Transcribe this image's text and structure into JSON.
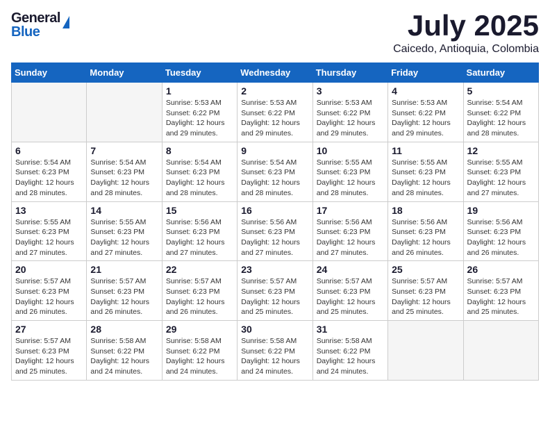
{
  "header": {
    "logo_general": "General",
    "logo_blue": "Blue",
    "month_title": "July 2025",
    "subtitle": "Caicedo, Antioquia, Colombia"
  },
  "calendar": {
    "days_of_week": [
      "Sunday",
      "Monday",
      "Tuesday",
      "Wednesday",
      "Thursday",
      "Friday",
      "Saturday"
    ],
    "weeks": [
      [
        {
          "day": "",
          "info": ""
        },
        {
          "day": "",
          "info": ""
        },
        {
          "day": "1",
          "info": "Sunrise: 5:53 AM\nSunset: 6:22 PM\nDaylight: 12 hours and 29 minutes."
        },
        {
          "day": "2",
          "info": "Sunrise: 5:53 AM\nSunset: 6:22 PM\nDaylight: 12 hours and 29 minutes."
        },
        {
          "day": "3",
          "info": "Sunrise: 5:53 AM\nSunset: 6:22 PM\nDaylight: 12 hours and 29 minutes."
        },
        {
          "day": "4",
          "info": "Sunrise: 5:53 AM\nSunset: 6:22 PM\nDaylight: 12 hours and 29 minutes."
        },
        {
          "day": "5",
          "info": "Sunrise: 5:54 AM\nSunset: 6:22 PM\nDaylight: 12 hours and 28 minutes."
        }
      ],
      [
        {
          "day": "6",
          "info": "Sunrise: 5:54 AM\nSunset: 6:23 PM\nDaylight: 12 hours and 28 minutes."
        },
        {
          "day": "7",
          "info": "Sunrise: 5:54 AM\nSunset: 6:23 PM\nDaylight: 12 hours and 28 minutes."
        },
        {
          "day": "8",
          "info": "Sunrise: 5:54 AM\nSunset: 6:23 PM\nDaylight: 12 hours and 28 minutes."
        },
        {
          "day": "9",
          "info": "Sunrise: 5:54 AM\nSunset: 6:23 PM\nDaylight: 12 hours and 28 minutes."
        },
        {
          "day": "10",
          "info": "Sunrise: 5:55 AM\nSunset: 6:23 PM\nDaylight: 12 hours and 28 minutes."
        },
        {
          "day": "11",
          "info": "Sunrise: 5:55 AM\nSunset: 6:23 PM\nDaylight: 12 hours and 28 minutes."
        },
        {
          "day": "12",
          "info": "Sunrise: 5:55 AM\nSunset: 6:23 PM\nDaylight: 12 hours and 27 minutes."
        }
      ],
      [
        {
          "day": "13",
          "info": "Sunrise: 5:55 AM\nSunset: 6:23 PM\nDaylight: 12 hours and 27 minutes."
        },
        {
          "day": "14",
          "info": "Sunrise: 5:55 AM\nSunset: 6:23 PM\nDaylight: 12 hours and 27 minutes."
        },
        {
          "day": "15",
          "info": "Sunrise: 5:56 AM\nSunset: 6:23 PM\nDaylight: 12 hours and 27 minutes."
        },
        {
          "day": "16",
          "info": "Sunrise: 5:56 AM\nSunset: 6:23 PM\nDaylight: 12 hours and 27 minutes."
        },
        {
          "day": "17",
          "info": "Sunrise: 5:56 AM\nSunset: 6:23 PM\nDaylight: 12 hours and 27 minutes."
        },
        {
          "day": "18",
          "info": "Sunrise: 5:56 AM\nSunset: 6:23 PM\nDaylight: 12 hours and 26 minutes."
        },
        {
          "day": "19",
          "info": "Sunrise: 5:56 AM\nSunset: 6:23 PM\nDaylight: 12 hours and 26 minutes."
        }
      ],
      [
        {
          "day": "20",
          "info": "Sunrise: 5:57 AM\nSunset: 6:23 PM\nDaylight: 12 hours and 26 minutes."
        },
        {
          "day": "21",
          "info": "Sunrise: 5:57 AM\nSunset: 6:23 PM\nDaylight: 12 hours and 26 minutes."
        },
        {
          "day": "22",
          "info": "Sunrise: 5:57 AM\nSunset: 6:23 PM\nDaylight: 12 hours and 26 minutes."
        },
        {
          "day": "23",
          "info": "Sunrise: 5:57 AM\nSunset: 6:23 PM\nDaylight: 12 hours and 25 minutes."
        },
        {
          "day": "24",
          "info": "Sunrise: 5:57 AM\nSunset: 6:23 PM\nDaylight: 12 hours and 25 minutes."
        },
        {
          "day": "25",
          "info": "Sunrise: 5:57 AM\nSunset: 6:23 PM\nDaylight: 12 hours and 25 minutes."
        },
        {
          "day": "26",
          "info": "Sunrise: 5:57 AM\nSunset: 6:23 PM\nDaylight: 12 hours and 25 minutes."
        }
      ],
      [
        {
          "day": "27",
          "info": "Sunrise: 5:57 AM\nSunset: 6:23 PM\nDaylight: 12 hours and 25 minutes."
        },
        {
          "day": "28",
          "info": "Sunrise: 5:58 AM\nSunset: 6:22 PM\nDaylight: 12 hours and 24 minutes."
        },
        {
          "day": "29",
          "info": "Sunrise: 5:58 AM\nSunset: 6:22 PM\nDaylight: 12 hours and 24 minutes."
        },
        {
          "day": "30",
          "info": "Sunrise: 5:58 AM\nSunset: 6:22 PM\nDaylight: 12 hours and 24 minutes."
        },
        {
          "day": "31",
          "info": "Sunrise: 5:58 AM\nSunset: 6:22 PM\nDaylight: 12 hours and 24 minutes."
        },
        {
          "day": "",
          "info": ""
        },
        {
          "day": "",
          "info": ""
        }
      ]
    ]
  }
}
